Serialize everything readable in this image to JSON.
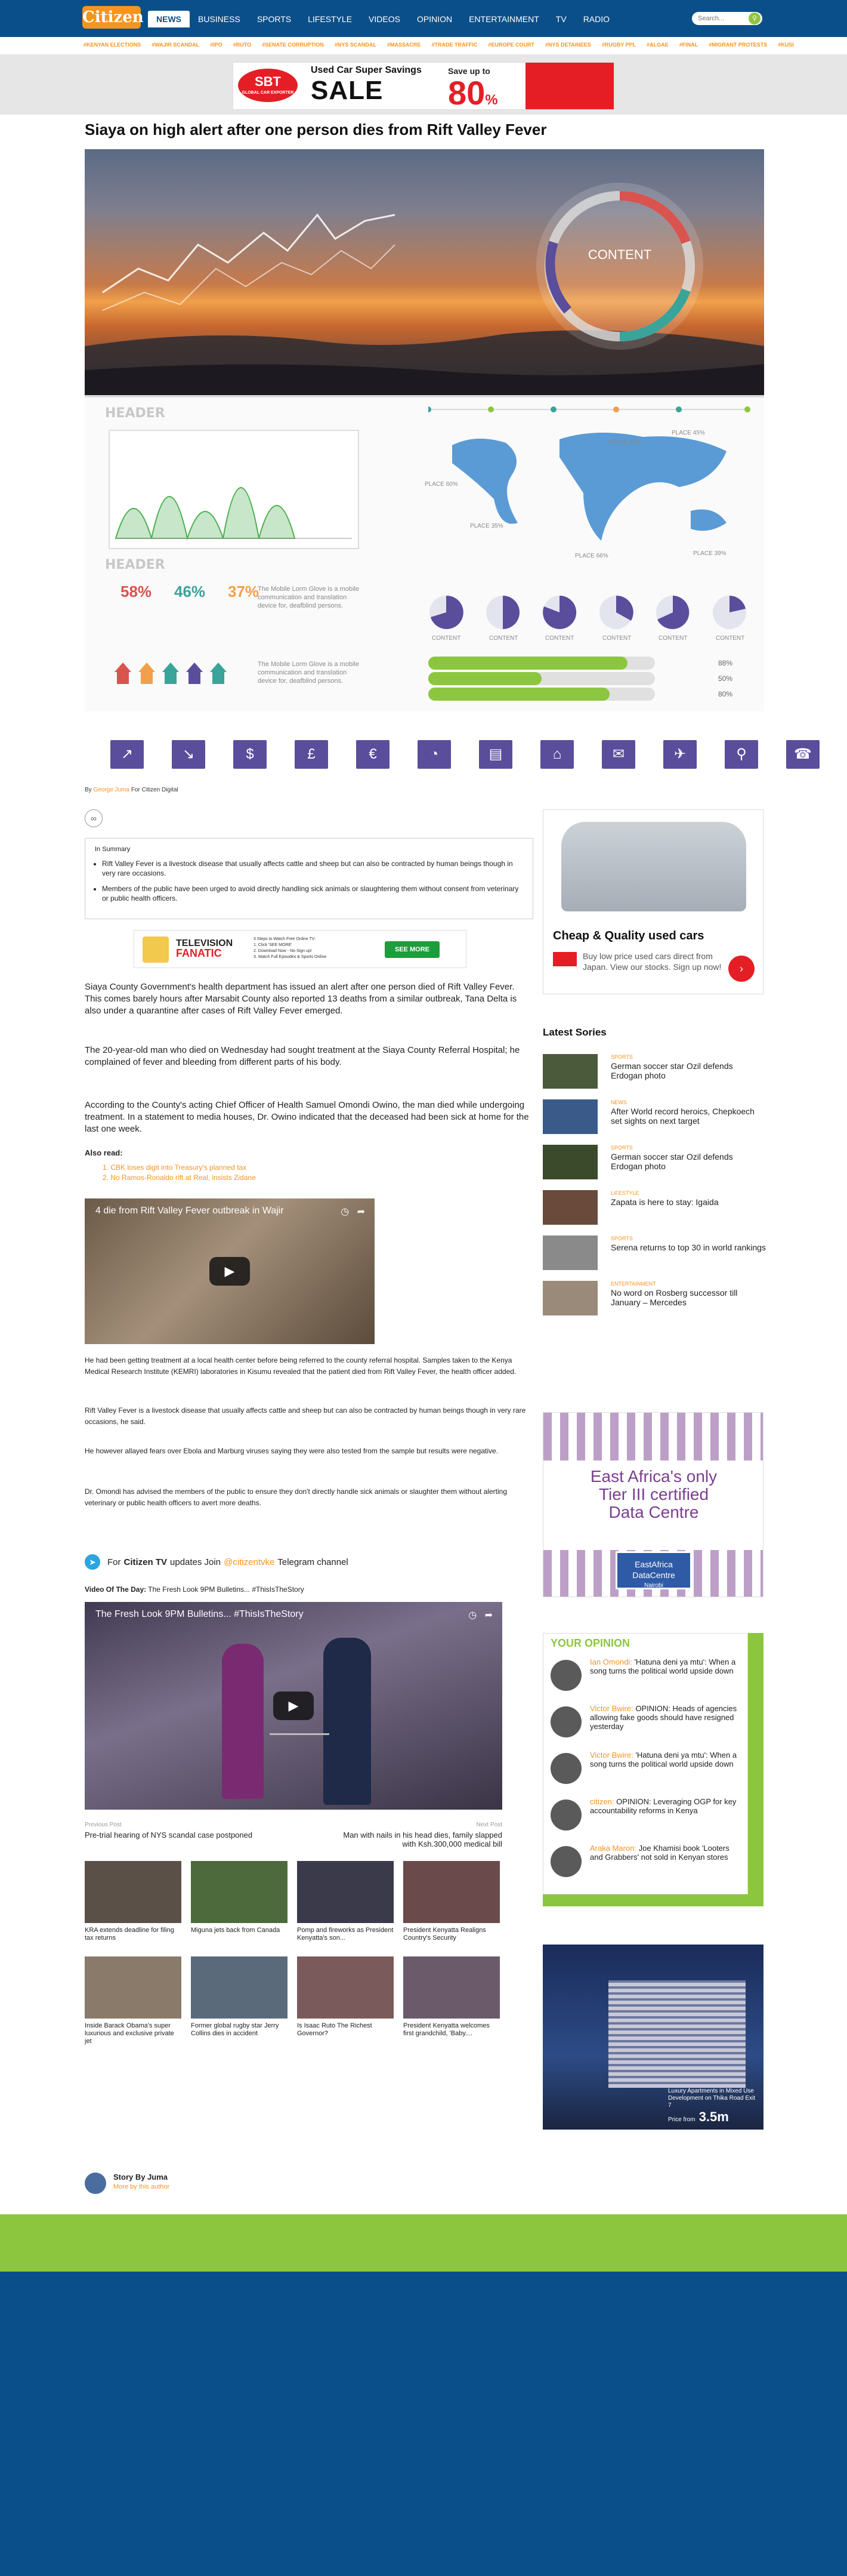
{
  "header": {
    "logo": "Citizen",
    "nav": [
      "NEWS",
      "BUSINESS",
      "SPORTS",
      "LIFESTYLE",
      "VIDEOS",
      "OPINION",
      "ENTERTAINMENT",
      "TV",
      "RADIO"
    ],
    "search_placeholder": "Search...",
    "subnav": [
      "#KENYAN ELECTIONS",
      "#WAJIR SCANDAL",
      "#IPO",
      "#RUTO",
      "#SENATE CORRUPTION",
      "#NYS SCANDAL",
      "#MASSACRE",
      "#TRADE TRAFFIC",
      "#EUROPE COURT",
      "#NYS DETAINEES",
      "#RUGBY PPL",
      "#ALGAE",
      "#FINAL",
      "#MIGRANT PROTESTS",
      "#KUSI"
    ]
  },
  "top_ad": {
    "brand": "SBT",
    "brand_sub": "GLOBAL CAR EXPORTER",
    "line1": "Used Car",
    "line1b": "Super Savings",
    "line2": "SALE",
    "save": "Save up to",
    "percent": "80",
    "percent_sign": "%"
  },
  "article": {
    "headline": "Siaya on high alert after one person dies from Rift Valley Fever",
    "byline_prefix": "By",
    "byline_name": "George Juma",
    "byline_suffix": "For Citizen Digital",
    "summary_title": "In Summary",
    "summary": [
      "Rift Valley Fever is a livestock disease that usually affects cattle and sheep but can also be contracted by human beings though in very rare occasions.",
      "Members of the public have been urged to avoid directly handling sick animals or slaughtering them without consent from veterinary or public health officers."
    ],
    "p1": "Siaya County Government's health department has issued an alert after one person died of Rift Valley Fever. This comes barely hours after Marsabit County also reported 13 deaths from a similar outbreak, Tana Delta is also under a quarantine after cases of Rift Valley Fever emerged.",
    "p2": "The 20-year-old man who died on Wednesday had sought treatment at the Siaya County Referral Hospital; he complained of fever and bleeding from different parts of his body.",
    "p3": "According to the County's acting Chief Officer of Health Samuel Omondi Owino, the man died while undergoing treatment. In a statement to media houses, Dr. Owino indicated that the deceased had been sick at home for the last one week.",
    "also_read_label": "Also read:",
    "also_read": [
      "1. CBK loses digit into Treasury's planned tax",
      "2. No Ramos-Ronaldo rift at Real, insists Zidane"
    ],
    "video1_title": "4 die from Rift Valley Fever outbreak in Wajir",
    "p4": "He had been getting treatment at a local health center before being referred to the county referral hospital. Samples taken to the Kenya Medical Research Institute (KEMRI) laboratories in Kisumu revealed that the patient died from Rift Valley Fever, the health officer added.",
    "p5": "Rift Valley Fever is a livestock disease that usually affects cattle and sheep but can also be contracted by human beings though in very rare occasions, he said.",
    "p6": "He however allayed fears over Ebola and Marburg viruses saying they were also tested from the sample but results were negative.",
    "p7": "Dr. Omondi has advised the members of the public to ensure they don't directly handle sick animals or slaughter them without alerting veterinary or public health officers to avert more deaths.",
    "telegram_pre": "For",
    "telegram_brand": "Citizen TV",
    "telegram_mid": "updates Join",
    "telegram_handle": "@citizentvke",
    "telegram_post": "Telegram channel",
    "votd_label": "Video Of The Day:",
    "votd_title": "The Fresh Look 9PM Bulletins... #ThisIsTheStory",
    "video2_title": "The Fresh Look 9PM Bulletins... #ThisIsTheStory",
    "prev_label": "Previous Post",
    "prev_title": "Pre-trial hearing of NYS scandal case postponed",
    "next_label": "Next Post",
    "next_title": "Man with nails in his head dies, family slapped with Ksh.300,000 medical bill",
    "related": [
      "KRA extends deadline for filing tax returns",
      "Miguna jets back from Canada",
      "Pomp and fireworks as President Kenyatta's son...",
      "President Kenyatta Realigns Country's Security",
      "Inside Barack Obama's super luxurious and exclusive private jet",
      "Former global rugby star Jerry Collins dies in accident",
      "Is Isaac Ruto The Richest Governor?",
      "President Kenyatta welcomes first grandchild, 'Baby...."
    ],
    "author_label": "Story By Juma",
    "author_more": "More by this author"
  },
  "tv_ad": {
    "brand1": "TELEVISION",
    "brand2": "FANATIC",
    "steps": [
      "3 Steps to Watch Free Online TV:",
      "1. Click 'SEE MORE'",
      "2. Download Now - No Sign up!",
      "3. Watch Full Episodes & Sports Online"
    ],
    "cta": "SEE MORE"
  },
  "sidebar": {
    "car_ad_title": "Cheap & Quality used cars",
    "car_ad_sub": "Buy low price used cars direct from Japan. View our stocks. Sign up now!",
    "latest_title": "Latest Sories",
    "latest": [
      {
        "cat": "SPORTS",
        "title": "German soccer star Ozil defends Erdogan photo"
      },
      {
        "cat": "NEWS",
        "title": "After World record heroics, Chepkoech set sights on next target"
      },
      {
        "cat": "SPORTS",
        "title": "German soccer star Ozil defends Erdogan photo"
      },
      {
        "cat": "LIFESTYLE",
        "title": "Zapata is here to stay: Igaida"
      },
      {
        "cat": "SPORTS",
        "title": "Serena returns to top 30 in world rankings"
      },
      {
        "cat": "ENTERTAINMENT",
        "title": "No word on Rosberg successor till January – Mercedes"
      }
    ],
    "dc_line1": "East Africa's only",
    "dc_line2": "Tier III certified",
    "dc_line3": "Data Centre",
    "dc_logo1": "EastAfrica",
    "dc_logo2": "DataCentre",
    "dc_logo3": "Nairobi",
    "opinion_title": "YOUR OPINION",
    "opinions": [
      {
        "author": "Ian Omondi:",
        "text": "'Hatuna deni ya mtu': When a song turns the political world upside down"
      },
      {
        "author": "Victor Bwire:",
        "text": "OPINION: Heads of agencies allowing fake goods should have resigned yesterday"
      },
      {
        "author": "Victor Bwire:",
        "text": "'Hatuna deni ya mtu': When a song turns the political world upside down"
      },
      {
        "author": "citizen:",
        "text": "OPINION: Leveraging OGP for key accountability reforms in Kenya"
      },
      {
        "author": "Araka Maron:",
        "text": "Joe Khamisi book 'Looters and Grabbers' not sold in Kenyan stores"
      }
    ],
    "re_text": "Luxury Apartments in Mixed Use Development on Thika Road Exit 7",
    "re_price": "3.5m",
    "re_price_prefix": "Price from"
  },
  "infographic": {
    "content_word": "CONTENT",
    "header_word": "HEADER",
    "body_text": "The Mobile Lorm Glove is a mobile communication and translation device for, deafblind persons.",
    "people_pcts": [
      "58%",
      "46%",
      "37%"
    ],
    "place_word": "PLACE",
    "place_pcts": [
      "25%",
      "45%",
      "60%",
      "35%",
      "66%",
      "39%"
    ],
    "pie_labels": [
      "CONTENT",
      "CONTENT",
      "CONTENT",
      "CONTENT",
      "CONTENT",
      "CONTENT"
    ],
    "bars": [
      {
        "label": "88%",
        "value": 88
      },
      {
        "label": "50%",
        "value": 50
      },
      {
        "label": "80%",
        "value": 80
      }
    ]
  },
  "icon_bar": [
    "chart-up-icon",
    "chart-down-icon",
    "dollar-icon",
    "pound-icon",
    "euro-icon",
    "pie-icon",
    "cart-icon",
    "home-icon",
    "mail-icon",
    "plane-icon",
    "search-icon",
    "phone-icon",
    "download-icon"
  ],
  "colors": {
    "brand_blue": "#0b4f8a",
    "accent_orange": "#f7941d",
    "green": "#8cc63f",
    "icon_purple": "#5a4d9c"
  }
}
